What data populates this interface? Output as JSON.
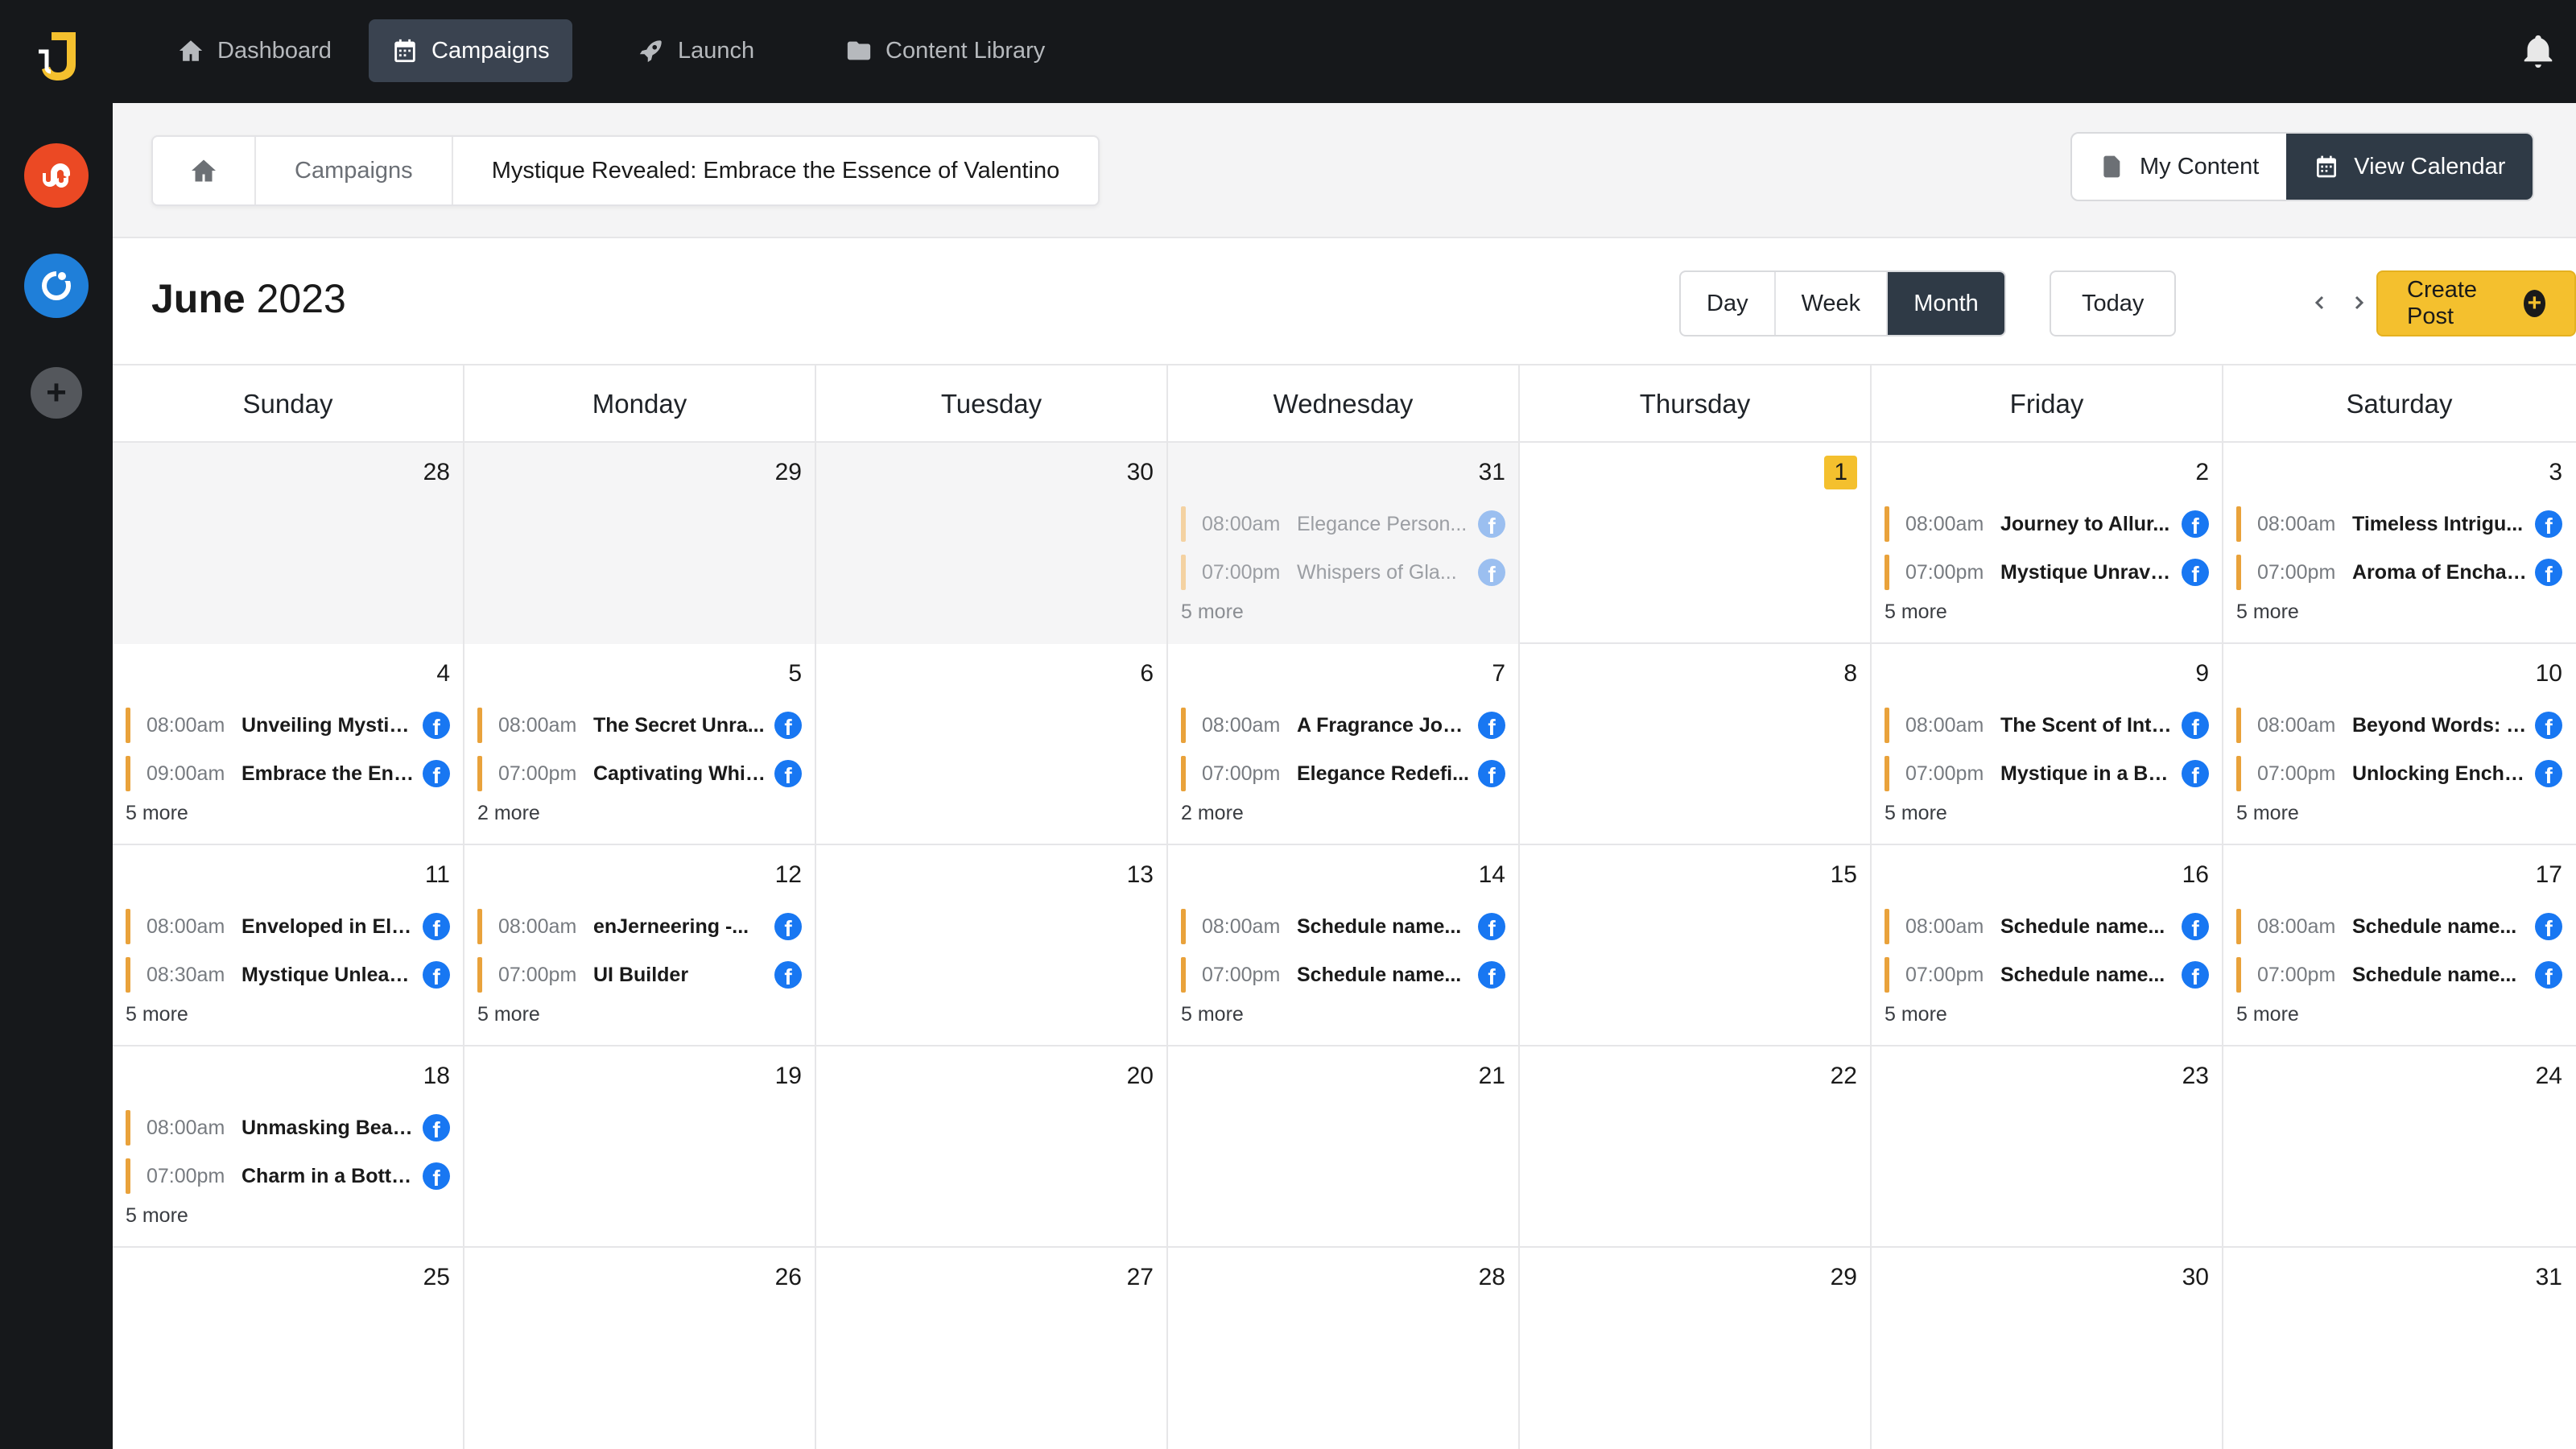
{
  "nav": [
    {
      "label": "Dashboard",
      "icon": "home-icon",
      "active": false
    },
    {
      "label": "Campaigns",
      "icon": "calendar-icon",
      "active": true
    },
    {
      "label": "Launch",
      "icon": "rocket-icon",
      "active": false
    },
    {
      "label": "Content Library",
      "icon": "folder-icon",
      "active": false
    }
  ],
  "rail": {
    "apps": [
      "stumbleupon-icon",
      "app-icon",
      "add-icon"
    ],
    "add_label": "+"
  },
  "breadcrumb": {
    "items": [
      "Campaigns",
      "Mystique Revealed: Embrace the Essence of Valentino"
    ]
  },
  "actions": {
    "my_content": "My Content",
    "view_calendar": "View Calendar"
  },
  "calendar": {
    "month": "June",
    "year": "2023",
    "views": [
      "Day",
      "Week",
      "Month"
    ],
    "active_view": "Month",
    "today_label": "Today",
    "create_label": "Create Post",
    "create_icon": "+",
    "days_of_week": [
      "Sunday",
      "Monday",
      "Tuesday",
      "Wednesday",
      "Thursday",
      "Friday",
      "Saturday"
    ],
    "accent_color": "#e9a23b",
    "today_color": "#f4c02e",
    "weeks": [
      [
        {
          "day": "28",
          "muted": true,
          "events": [],
          "more": ""
        },
        {
          "day": "29",
          "muted": true,
          "events": [],
          "more": ""
        },
        {
          "day": "30",
          "muted": true,
          "events": [],
          "more": ""
        },
        {
          "day": "31",
          "muted": true,
          "faded": true,
          "events": [
            {
              "time": "08:00am",
              "title": "Elegance Person..."
            },
            {
              "time": "07:00pm",
              "title": "Whispers of Gla..."
            }
          ],
          "more": "5 more"
        },
        {
          "day": "1",
          "today": true,
          "events": [],
          "more": ""
        },
        {
          "day": "2",
          "events": [
            {
              "time": "08:00am",
              "title": "Journey to Allur..."
            },
            {
              "time": "07:00pm",
              "title": "Mystique Unrave..."
            }
          ],
          "more": "5 more"
        },
        {
          "day": "3",
          "events": [
            {
              "time": "08:00am",
              "title": "Timeless Intrigu..."
            },
            {
              "time": "07:00pm",
              "title": "Aroma of Enchan..."
            }
          ],
          "more": "5 more"
        }
      ],
      [
        {
          "day": "4",
          "events": [
            {
              "time": "08:00am",
              "title": "Unveiling Mystiq..."
            },
            {
              "time": "09:00am",
              "title": "Embrace the Eni..."
            }
          ],
          "more": "5 more"
        },
        {
          "day": "5",
          "events": [
            {
              "time": "08:00am",
              "title": "The Secret Unra..."
            },
            {
              "time": "07:00pm",
              "title": "Captivating Whis..."
            }
          ],
          "more": "2 more"
        },
        {
          "day": "6",
          "events": [],
          "more": ""
        },
        {
          "day": "7",
          "events": [
            {
              "time": "08:00am",
              "title": "A Fragrance Jou..."
            },
            {
              "time": "07:00pm",
              "title": "Elegance Redefi..."
            }
          ],
          "more": "2 more"
        },
        {
          "day": "8",
          "events": [],
          "more": ""
        },
        {
          "day": "9",
          "events": [
            {
              "time": "08:00am",
              "title": "The Scent of Intr..."
            },
            {
              "time": "07:00pm",
              "title": "Mystique in a Bo..."
            }
          ],
          "more": "5 more"
        },
        {
          "day": "10",
          "events": [
            {
              "time": "08:00am",
              "title": "Beyond Words: E..."
            },
            {
              "time": "07:00pm",
              "title": "Unlocking Encha..."
            }
          ],
          "more": "5 more"
        }
      ],
      [
        {
          "day": "11",
          "events": [
            {
              "time": "08:00am",
              "title": "Enveloped in Ele..."
            },
            {
              "time": "08:30am",
              "title": "Mystique Unleas..."
            }
          ],
          "more": "5 more"
        },
        {
          "day": "12",
          "events": [
            {
              "time": "08:00am",
              "title": "enJerneering -..."
            },
            {
              "time": "07:00pm",
              "title": "UI Builder"
            }
          ],
          "more": "5 more"
        },
        {
          "day": "13",
          "events": [],
          "more": ""
        },
        {
          "day": "14",
          "events": [
            {
              "time": "08:00am",
              "title": "Schedule name..."
            },
            {
              "time": "07:00pm",
              "title": "Schedule name..."
            }
          ],
          "more": "5 more"
        },
        {
          "day": "15",
          "events": [],
          "more": ""
        },
        {
          "day": "16",
          "events": [
            {
              "time": "08:00am",
              "title": "Schedule name..."
            },
            {
              "time": "07:00pm",
              "title": "Schedule name..."
            }
          ],
          "more": "5 more"
        },
        {
          "day": "17",
          "events": [
            {
              "time": "08:00am",
              "title": "Schedule name..."
            },
            {
              "time": "07:00pm",
              "title": "Schedule name..."
            }
          ],
          "more": "5 more"
        }
      ],
      [
        {
          "day": "18",
          "events": [
            {
              "time": "08:00am",
              "title": "Unmasking Beau..."
            },
            {
              "time": "07:00pm",
              "title": "Charm in a Bottle..."
            }
          ],
          "more": "5 more"
        },
        {
          "day": "19",
          "events": [],
          "more": ""
        },
        {
          "day": "20",
          "events": [],
          "more": ""
        },
        {
          "day": "21",
          "events": [],
          "more": ""
        },
        {
          "day": "22",
          "events": [],
          "more": ""
        },
        {
          "day": "23",
          "events": [],
          "more": ""
        },
        {
          "day": "24",
          "events": [],
          "more": ""
        }
      ],
      [
        {
          "day": "25",
          "events": [],
          "more": ""
        },
        {
          "day": "26",
          "events": [],
          "more": ""
        },
        {
          "day": "27",
          "events": [],
          "more": ""
        },
        {
          "day": "28",
          "events": [],
          "more": ""
        },
        {
          "day": "29",
          "events": [],
          "more": ""
        },
        {
          "day": "30",
          "events": [],
          "more": ""
        },
        {
          "day": "31",
          "events": [],
          "more": ""
        }
      ]
    ],
    "event_platform_icon": "facebook-icon",
    "event_platform_glyph": "f"
  }
}
